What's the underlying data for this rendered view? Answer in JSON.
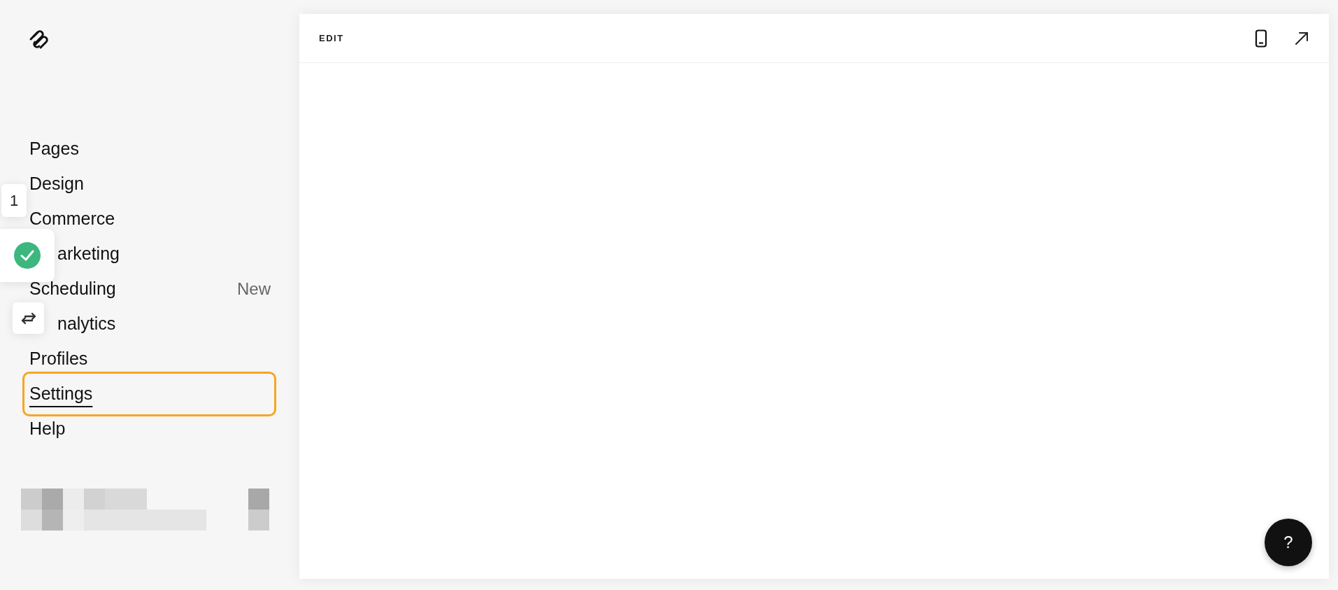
{
  "sidebar": {
    "menu": [
      {
        "label": "Pages",
        "selected": false,
        "highlighted": false
      },
      {
        "label": "Design",
        "selected": false,
        "highlighted": false
      },
      {
        "label": "Commerce",
        "selected": false,
        "highlighted": false
      },
      {
        "label": "arketing",
        "selected": false,
        "highlighted": false,
        "partly_hidden": true
      },
      {
        "label": "Scheduling",
        "selected": false,
        "highlighted": false,
        "badge": "New"
      },
      {
        "label": "nalytics",
        "selected": false,
        "highlighted": false,
        "partly_hidden": true
      },
      {
        "label": "Profiles",
        "selected": false,
        "highlighted": false
      },
      {
        "label": "Settings",
        "selected": true,
        "highlighted": true
      },
      {
        "label": "Help",
        "selected": false,
        "highlighted": false
      }
    ]
  },
  "overlay": {
    "counter": "1",
    "status_checked": true
  },
  "editor": {
    "mode_label": "EDIT",
    "help_label": "?"
  }
}
